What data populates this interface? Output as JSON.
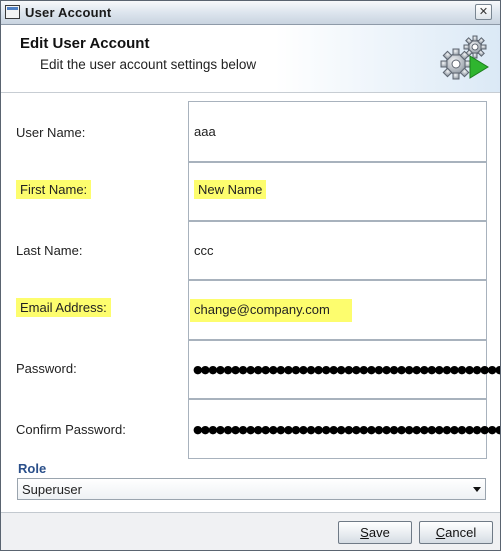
{
  "window": {
    "title": "User Account",
    "close_glyph": "✕"
  },
  "header": {
    "title": "Edit User Account",
    "subtitle": "Edit the user account settings below",
    "icon": "gears-play-icon"
  },
  "form": {
    "user_name": {
      "label": "User Name:",
      "value": "aaa"
    },
    "first_name": {
      "label": "First Name:",
      "value": "New Name",
      "highlighted": true
    },
    "last_name": {
      "label": "Last Name:",
      "value": "ccc"
    },
    "email": {
      "label": "Email Address:",
      "value": "change@company.com",
      "highlighted": true
    },
    "password": {
      "label": "Password:",
      "value": "●●●●●●●●●●●●●●●●●●●●●●●●●●●●●●●●●●●●●●●●●●●●●●●●●●●●●●●●●●●●●●●●●●●●"
    },
    "confirm_password": {
      "label": "Confirm Password:",
      "value": "●●●●●●●●●●●●●●●●●●●●●●●●●●●●●●●●●●●●●●●●●●●●●●●●●●●●●●●●●●●●●●●●●●●●"
    }
  },
  "role": {
    "label": "Role",
    "selected": "Superuser"
  },
  "buttons": {
    "save": {
      "mnemonic": "S",
      "rest": "ave"
    },
    "cancel": {
      "mnemonic": "C",
      "rest": "ancel"
    }
  },
  "colors": {
    "highlight": "#fdfd6e",
    "role_label": "#2a4f8a",
    "gear_play": "#2fb52f"
  }
}
